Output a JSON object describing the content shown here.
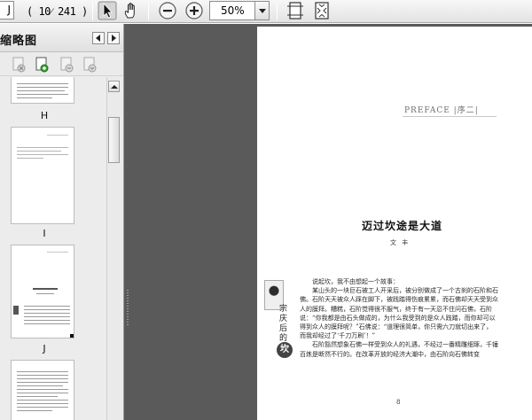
{
  "toolbar": {
    "current_page": "J",
    "page_count": "( 10⁄ 241 )",
    "zoom_value": "50%",
    "icons": {
      "select": "select-arrow-icon",
      "hand": "hand-icon",
      "zoom_out": "zoom-out-icon",
      "zoom_in": "zoom-in-icon",
      "fit_page": "fit-page-icon",
      "fit_width": "fit-width-icon"
    }
  },
  "panel": {
    "title": "缩略图",
    "tool_icons": [
      "delete-page-icon",
      "insert-page-icon",
      "extract-page-icon",
      "replace-page-icon"
    ]
  },
  "thumbnails": [
    {
      "label": "H"
    },
    {
      "label": "I"
    },
    {
      "label": "J"
    }
  ],
  "document": {
    "preface": "PREFACE |序二|",
    "title": "迈过坎途是大道",
    "author": "文 丰",
    "sidebar_text": "宗庆后的",
    "sidebar_char": "坎",
    "paragraphs": [
      "说起坎，我不由想起一个故事：",
      "某山头的一块巨石被工人开采后，被分别做成了一个古刹的石阶和石佛。石阶天天被众人踩在脚下，被践踏得伤痕累累，而石佛却天天受到众人的膜拜。糟糕，石阶觉得很不服气，终于有一天忍不住问石佛，石阶说：“你我都是由石头做成的，为什么我受到的是众人践踏，而你却可以得到众人的膜拜呢？”石佛说：“道理很简单，你只需六刀就切出来了，而我却经过了‘千刀万刷’！”",
      "石阶豁然想象石佛一样受到众人的礼遇，不经过一番精雕细琢，千锤百炼是断然不行的。在改革开放的经济大潮中，由石阶向石佛转变"
    ],
    "page_number": "8"
  },
  "colors": {
    "viewer_bg": "#5a5a5a",
    "panel_bg": "#ececec",
    "toolbar_bg": "#e9e9e9"
  }
}
